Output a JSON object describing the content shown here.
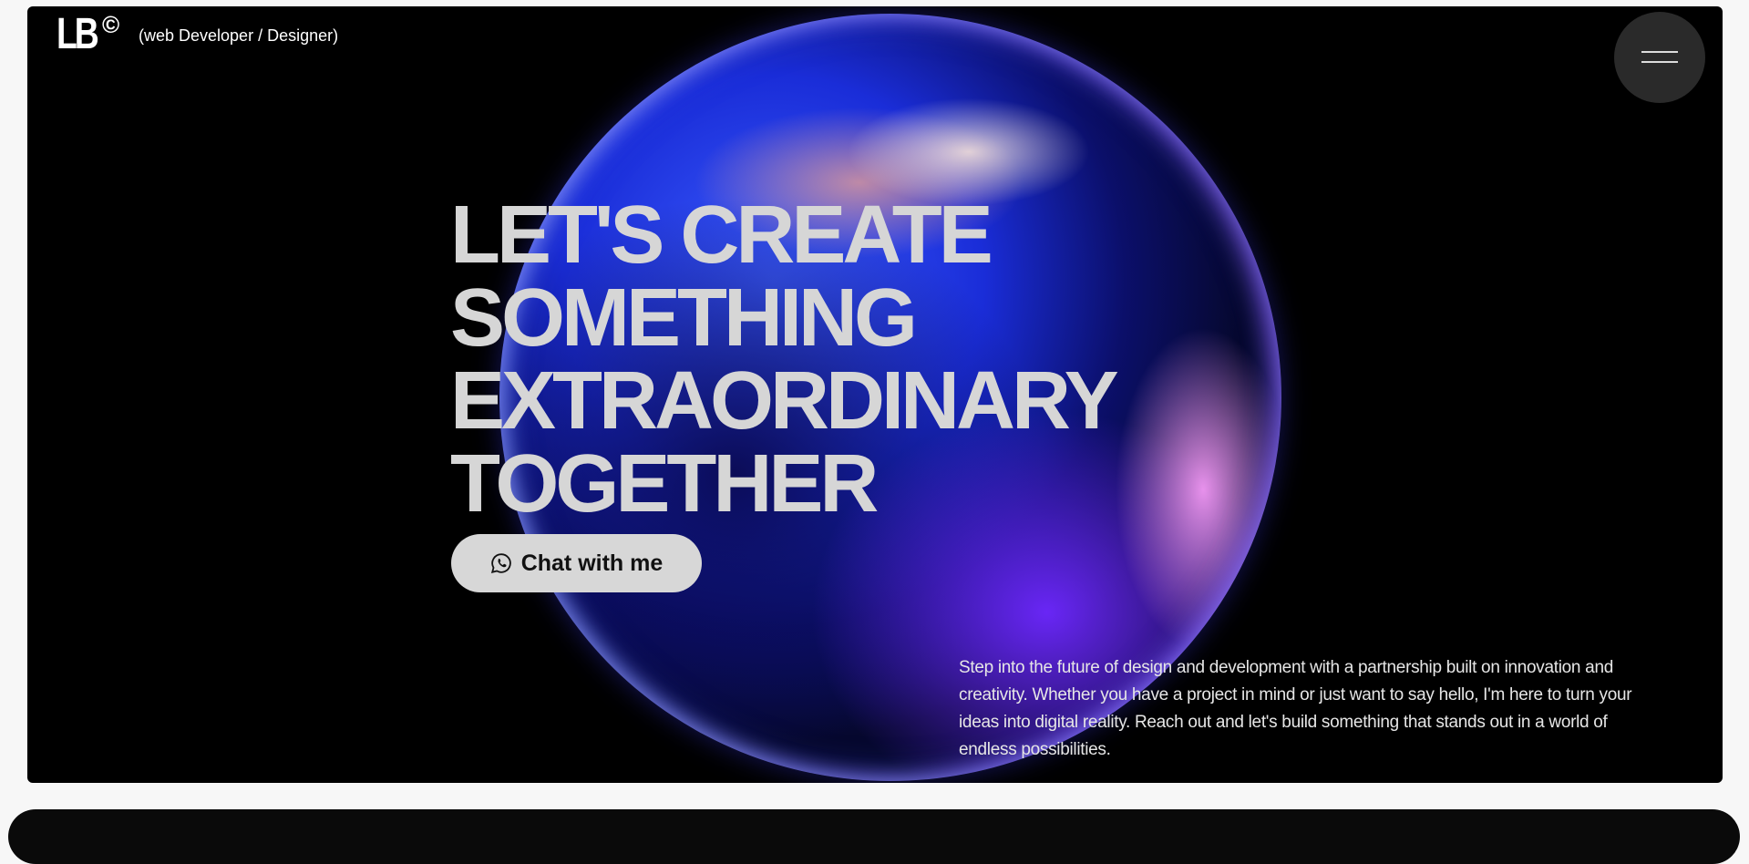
{
  "logo": {
    "mark": "LB",
    "copyright": "©"
  },
  "header": {
    "tagline": "(web Developer / Designer)"
  },
  "menu": {
    "icon": "hamburger-icon"
  },
  "hero": {
    "headline_lines": [
      "LET'S CREATE",
      "SOMETHING",
      "EXTRAORDINARY",
      "TOGETHER"
    ],
    "cta_label": "Chat with me",
    "cta_icon": "whatsapp-icon",
    "description": "Step into the future of design and development with a partnership built on innovation and creativity. Whether you have a project in mind or just want to say hello, I'm here to turn your ideas into digital reality. Reach out and let's build something that stands out in a world of endless possibilities."
  },
  "colors": {
    "hero_background": "#000000",
    "page_background": "#f7f7f7",
    "headline": "#d6d6d6",
    "button_background": "#d7d7d7",
    "menu_button": "#2a2a2a",
    "orb_primary": "#1a2dd8",
    "orb_accent": "#6e28ff"
  }
}
